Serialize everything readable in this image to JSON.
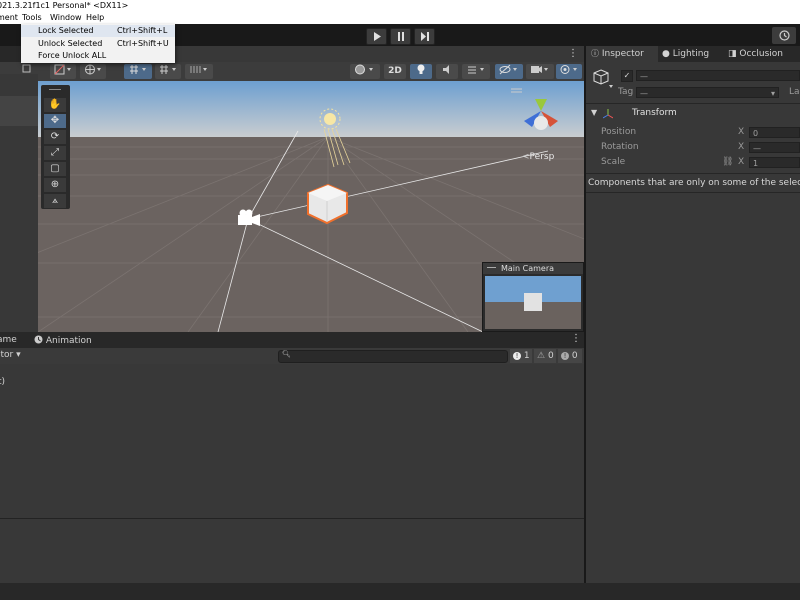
{
  "window": {
    "title": "021.3.21f1c1 Personal* <DX11>"
  },
  "menu": {
    "items": [
      {
        "label": "ment"
      },
      {
        "label": "Tools"
      },
      {
        "label": "Window"
      },
      {
        "label": "Help"
      }
    ]
  },
  "tools_menu": {
    "items": [
      {
        "label": "Lock Selected",
        "shortcut": "Ctrl+Shift+L"
      },
      {
        "label": "Unlock Selected",
        "shortcut": "Ctrl+Shift+U"
      },
      {
        "label": "Force Unlock ALL",
        "shortcut": ""
      }
    ]
  },
  "scene_toolbar": {
    "mode_2d": "2D"
  },
  "scene": {
    "persp_label": "Persp"
  },
  "camera_preview": {
    "title": "Main Camera"
  },
  "bottom_panel": {
    "tabs": [
      {
        "label": "ame"
      },
      {
        "label": "Animation"
      }
    ],
    "left_dropdown": "itor",
    "search_placeholder": "",
    "counts": {
      "errors": "1",
      "warnings": "0",
      "messages": "0"
    },
    "log_fragment": "t)"
  },
  "inspector": {
    "tabs": [
      {
        "label": "Inspector"
      },
      {
        "label": "Lighting"
      },
      {
        "label": "Occlusion"
      }
    ],
    "name_value": "—",
    "tag_label": "Tag",
    "tag_value": "—",
    "layer_label_fragment": "La",
    "component": {
      "title": "Transform"
    },
    "rows": [
      {
        "label": "Position",
        "axis": "X",
        "value": "0"
      },
      {
        "label": "Rotation",
        "axis": "X",
        "value": "—"
      },
      {
        "label": "Scale",
        "axis": "X",
        "value": "1"
      }
    ],
    "message": "Components that are only on some of the selecte"
  }
}
